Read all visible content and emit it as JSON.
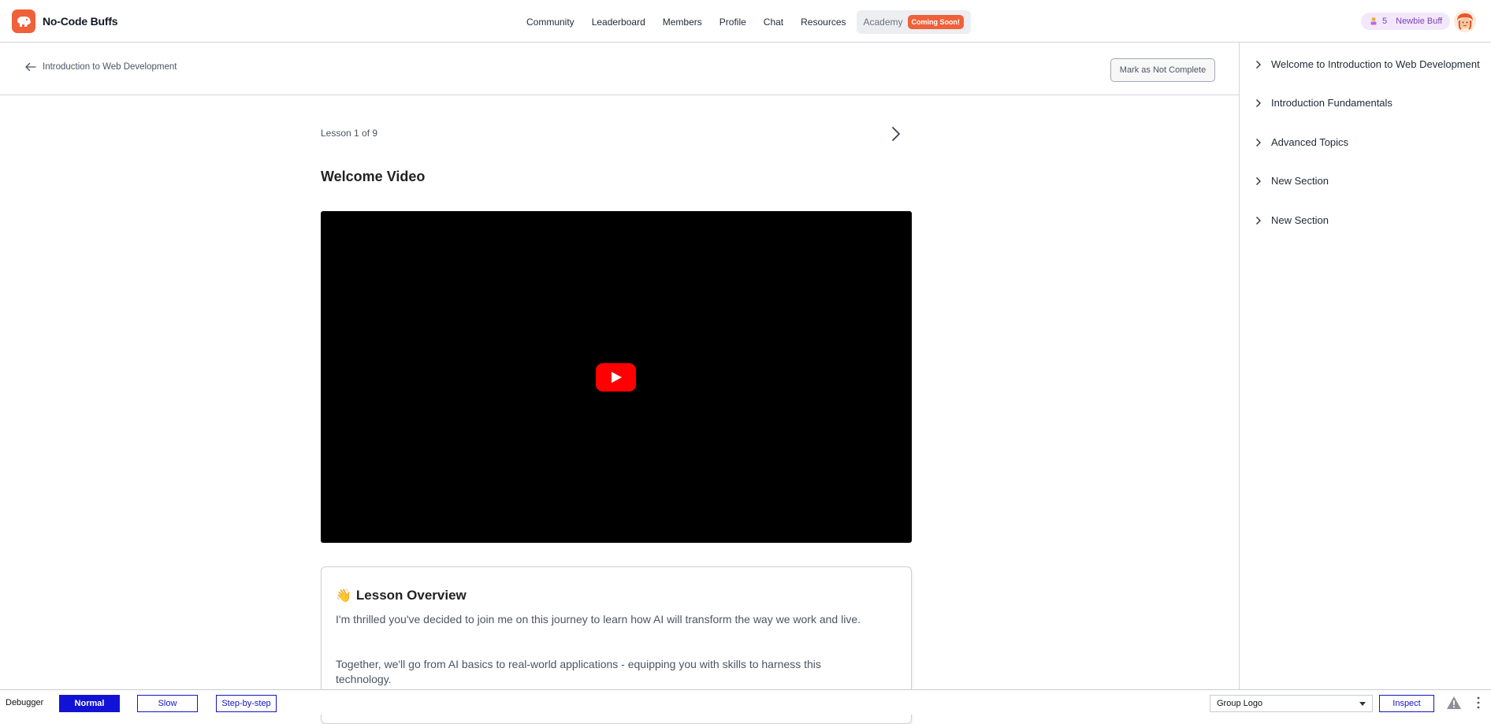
{
  "brand": {
    "name": "No-Code Buffs",
    "logo_icon": "dog-logo-icon",
    "accent": "#f0613a"
  },
  "nav": {
    "items": [
      {
        "label": "Community"
      },
      {
        "label": "Leaderboard"
      },
      {
        "label": "Members"
      },
      {
        "label": "Profile"
      },
      {
        "label": "Chat"
      },
      {
        "label": "Resources"
      }
    ],
    "academy": {
      "label": "Academy",
      "badge": "Coming Soon!"
    }
  },
  "user": {
    "level_number": "5",
    "level_name": "Newbie Buff",
    "level_icon": "trophy-icon",
    "avatar_icon": "avatar-face-icon"
  },
  "course": {
    "back_label": "Introduction to Web Development",
    "mark_button": "Mark as Not Complete"
  },
  "sections": [
    {
      "label": "Welcome to Introduction to Web Development"
    },
    {
      "label": "Introduction Fundamentals"
    },
    {
      "label": "Advanced Topics"
    },
    {
      "label": "New Section"
    },
    {
      "label": "New Section"
    }
  ],
  "lesson": {
    "count": "Lesson 1 of 9",
    "title": "Welcome Video",
    "video_icon": "youtube-play-icon"
  },
  "overview": {
    "emoji": "👋",
    "title": "Lesson Overview",
    "paragraphs": [
      "I'm thrilled you've decided to join me on this journey to learn how AI will transform the way we work and live.",
      "Together, we'll go from AI basics to real-world applications - equipping you with skills to harness this technology."
    ]
  },
  "debugger": {
    "label": "Debugger",
    "modes": [
      "Normal",
      "Slow",
      "Step-by-step"
    ],
    "active_mode": "Normal",
    "select_value": "Group Logo",
    "inspect_label": "Inspect"
  }
}
